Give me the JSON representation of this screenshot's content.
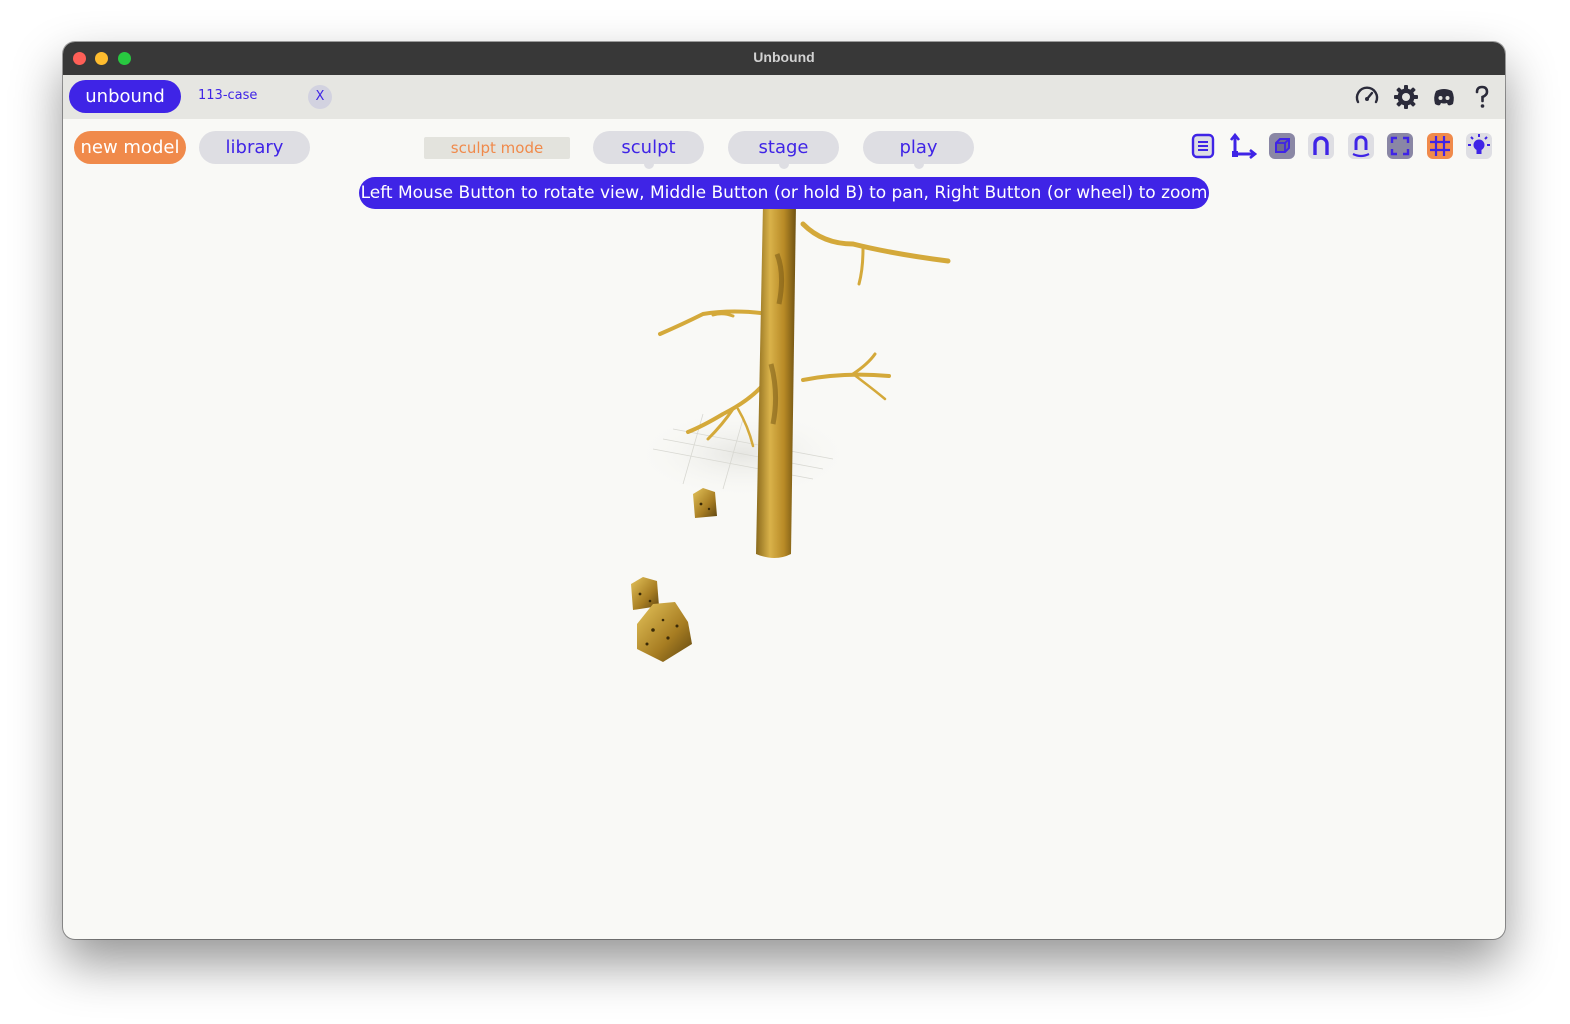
{
  "window": {
    "title": "Unbound"
  },
  "topbar": {
    "brand_label": "unbound",
    "tab_name": "113-case",
    "tab_close_label": "X",
    "icons": [
      "speedometer-icon",
      "gear-icon",
      "discord-icon",
      "help-icon"
    ]
  },
  "toolbar": {
    "new_model_label": "new model",
    "library_label": "library",
    "mode_label": "sculpt mode",
    "modes": [
      {
        "label": "sculpt"
      },
      {
        "label": "stage"
      },
      {
        "label": "play"
      }
    ],
    "tool_icons": [
      "list-icon",
      "axes-icon",
      "cube-icon",
      "magnet-icon",
      "mirror-magnet-icon",
      "frame-icon",
      "grid-icon",
      "light-icon"
    ]
  },
  "viewport": {
    "hint": "Left Mouse Button to rotate view, Middle Button (or hold B) to pan, Right Button (or wheel) to zoom"
  },
  "colors": {
    "accent": "#3f24e6",
    "orange": "#f08a4b",
    "titlebar": "#383838",
    "topbar": "#e6e6e2",
    "canvas": "#f9f9f6",
    "model": "#d4a93a"
  }
}
